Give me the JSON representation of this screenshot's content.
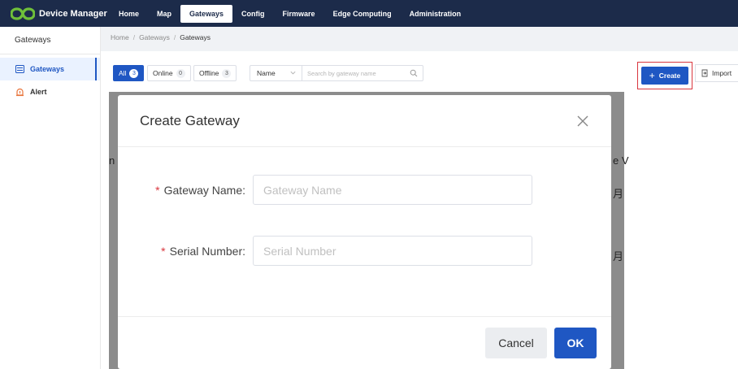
{
  "app": {
    "title": "Device Manager",
    "logo_icon": "infinity-logo-icon",
    "accent": "#1f57c3",
    "nav_bg": "#1c2b4a"
  },
  "nav": {
    "items": [
      {
        "label": "Home"
      },
      {
        "label": "Map"
      },
      {
        "label": "Gateways",
        "active": true
      },
      {
        "label": "Config"
      },
      {
        "label": "Firmware"
      },
      {
        "label": "Edge Computing"
      },
      {
        "label": "Administration"
      }
    ]
  },
  "sidebar": {
    "title": "Gateways",
    "items": [
      {
        "label": "Gateways",
        "icon": "gateway-icon",
        "active": true
      },
      {
        "label": "Alert",
        "icon": "alert-icon"
      }
    ]
  },
  "breadcrumb": {
    "items": [
      "Home",
      "Gateways",
      "Gateways"
    ],
    "separator": "/"
  },
  "filters": {
    "all": {
      "label": "All",
      "count": "3"
    },
    "online": {
      "label": "Online",
      "count": "0"
    },
    "offline": {
      "label": "Offline",
      "count": "3"
    }
  },
  "search": {
    "field_select": "Name",
    "placeholder": "Search by gateway name"
  },
  "toolbar": {
    "create_label": "Create",
    "import_label": "Import"
  },
  "background_table": {
    "left_fragment": "n",
    "right_fragment_1": "e V",
    "right_fragment_2": "月",
    "right_fragment_3": "月"
  },
  "dialog": {
    "title": "Create Gateway",
    "fields": [
      {
        "label": "Gateway Name",
        "placeholder": "Gateway Name",
        "required": true,
        "value": ""
      },
      {
        "label": "Serial Number",
        "placeholder": "Serial Number",
        "required": true,
        "value": ""
      }
    ],
    "required_mark": "*",
    "label_suffix": ":",
    "cancel_label": "Cancel",
    "ok_label": "OK"
  }
}
